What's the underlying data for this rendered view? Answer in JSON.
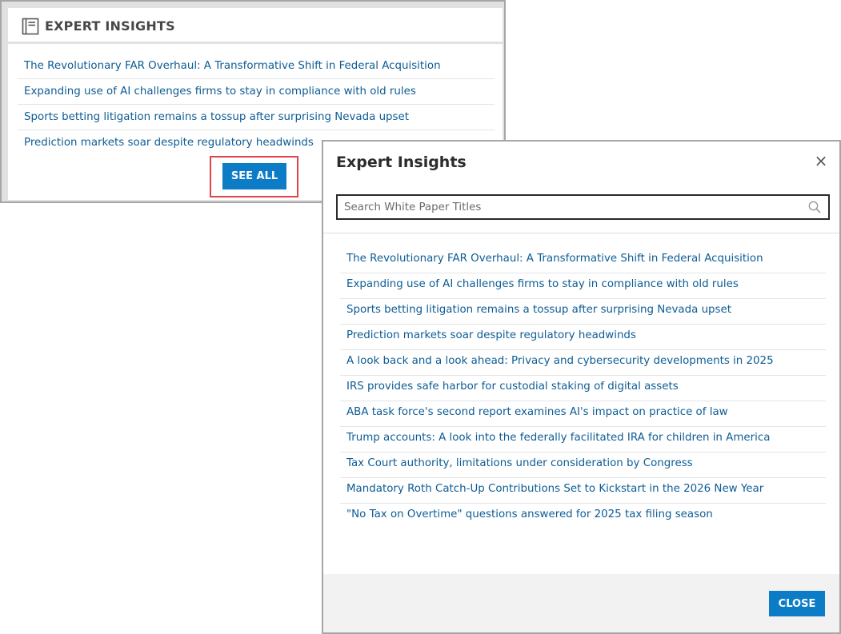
{
  "widget": {
    "title": "EXPERT INSIGHTS",
    "header_icon": "document-icon",
    "items": [
      "The Revolutionary FAR Overhaul: A Transformative Shift in Federal Acquisition",
      "Expanding use of AI challenges firms to stay in compliance with old rules",
      "Sports betting litigation remains a tossup after surprising Nevada upset",
      "Prediction markets soar despite regulatory headwinds"
    ],
    "see_all_label": "SEE ALL",
    "highlight_color": "#e0434a"
  },
  "modal": {
    "title": "Expert Insights",
    "close_x": "×",
    "search": {
      "placeholder": "Search White Paper Titles",
      "value": "",
      "icon": "search-icon"
    },
    "items": [
      "The Revolutionary FAR Overhaul: A Transformative Shift in Federal Acquisition",
      "Expanding use of AI challenges firms to stay in compliance with old rules",
      "Sports betting litigation remains a tossup after surprising Nevada upset",
      "Prediction markets soar despite regulatory headwinds",
      "A look back and a look ahead: Privacy and cybersecurity developments in 2025",
      "IRS provides safe harbor for custodial staking of digital assets",
      "ABA task force's second report examines AI's impact on practice of law",
      "Trump accounts: A look into the federally facilitated IRA for children in America",
      "Tax Court authority, limitations under consideration by Congress",
      "Mandatory Roth Catch-Up Contributions Set to Kickstart in the 2026 New Year",
      "\"No Tax on Overtime\" questions answered for 2025 tax filing season"
    ],
    "close_label": "CLOSE"
  },
  "colors": {
    "link": "#0d5c94",
    "button": "#0d7cc7",
    "border": "#a6a6a6"
  }
}
